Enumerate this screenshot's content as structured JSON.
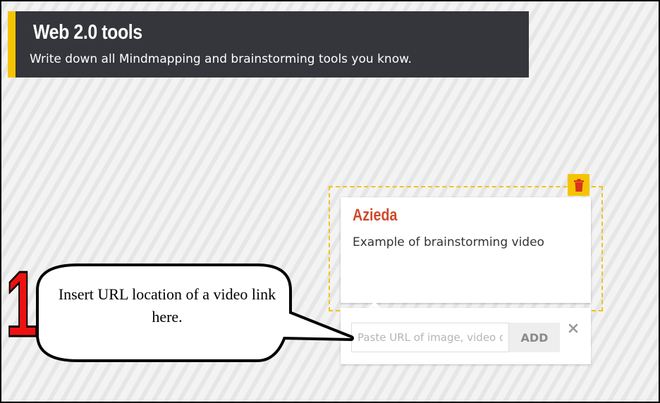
{
  "header": {
    "title": "Web 2.0 tools",
    "subtitle": "Write down all Mindmapping and brainstorming tools you know."
  },
  "post": {
    "author": "Azieda",
    "text": "Example of brainstorming video"
  },
  "attachment": {
    "placeholder": "Paste URL of image, video or file",
    "add_label": "ADD"
  },
  "annotation": {
    "step_number": "1",
    "callout_text": "Insert URL location of a video link here."
  },
  "icons": {
    "delete": "trash-icon",
    "close": "close-icon"
  },
  "colors": {
    "header_bg": "#34363b",
    "accent_yellow": "#f5c400",
    "author_red": "#d0492c",
    "step_red": "#ee1111"
  }
}
